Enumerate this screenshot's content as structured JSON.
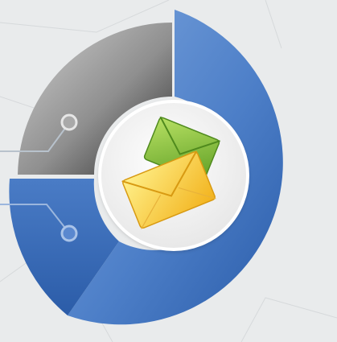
{
  "graphic": {
    "icon": "envelope-pair-icon",
    "segments": [
      "blue-large-segment",
      "gray-segment",
      "blue-lower-segment"
    ],
    "connectors": [
      "connector-upper",
      "connector-lower"
    ]
  },
  "colors": {
    "background": "#e9ebec",
    "blue_light": "#6f9ad6",
    "blue_dark": "#2c5eab",
    "gray_light": "#c9c9c9",
    "gray_dark": "#2f2f2f",
    "green_envelope": "#8cc63f",
    "yellow_envelope": "#ffd84a"
  }
}
